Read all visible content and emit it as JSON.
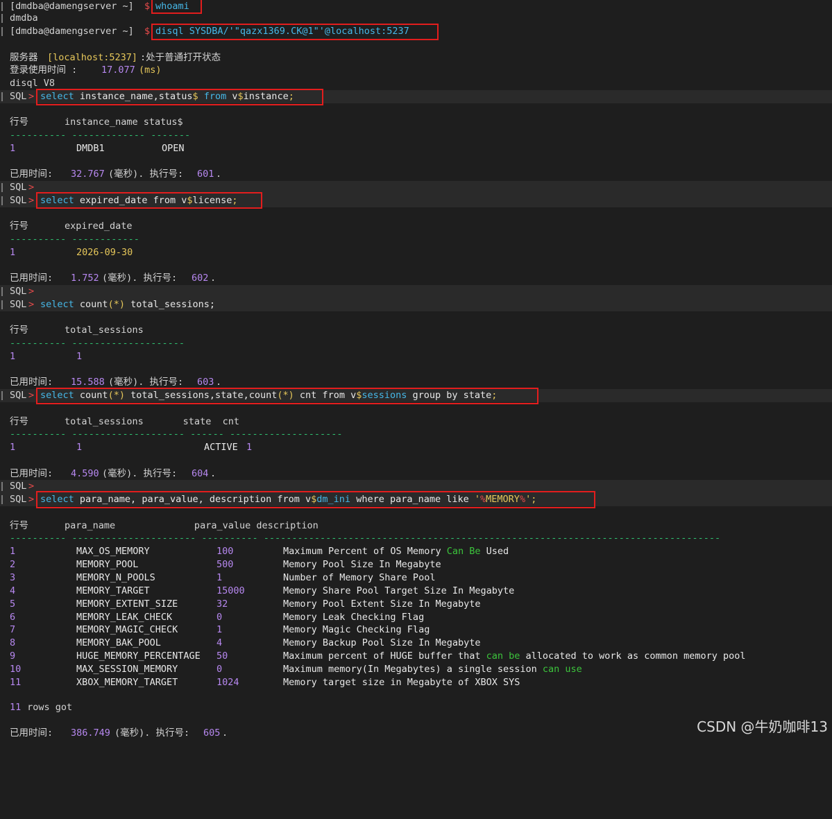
{
  "terminal": {
    "prompt_user": "[dmdba@damengserver ~]",
    "prompt_dollar": "$",
    "cmd_whoami": "whoami",
    "out_whoami": "dmdba",
    "cmd_disql": "disql SYSDBA/'\"qazx1369.CK@1\"'@localhost:5237",
    "server_label": "服务器",
    "server_addr": "[localhost:5237]",
    "server_state": ":处于普通打开状态",
    "login_label": "登录使用时间 : ",
    "login_value": "17.077",
    "ms_unit": "(ms)",
    "disql_version": "disql V8",
    "sql_prompt": "SQL",
    "gt": ">",
    "q1": {
      "select": "select",
      "cols": " instance_name,status",
      "dollar": "$",
      "from": " from ",
      "v": "v",
      "dollar2": "$",
      "tbl": "instance",
      "semi": ";",
      "header_row": "行号",
      "header_cols": "instance_name status$",
      "dashes": "---------- ------------- -------",
      "row_no": "1",
      "row_name": "DMDB1",
      "row_status": "OPEN",
      "elapsed_label": "已用时间: ",
      "elapsed_value": "32.767",
      "elapsed_unit": "(毫秒). 执行号:",
      "exec_no": "601",
      "dot": "."
    },
    "q2": {
      "select": "select",
      "rest": " expired_date from v",
      "dollar": "$",
      "tbl": "license",
      "semi": ";",
      "header_row": "行号",
      "header_cols": "expired_date",
      "dashes": "---------- ------------",
      "row_no": "1",
      "row_value": "2026-09-30",
      "elapsed_label": "已用时间: ",
      "elapsed_value": "1.752",
      "elapsed_unit": "(毫秒). 执行号:",
      "exec_no": "602",
      "dot": "."
    },
    "q3": {
      "select": "select",
      "rest1": " count",
      "paren": "(*)",
      "rest2": " total_sessions;",
      "header_row": "行号",
      "header_cols": "total_sessions",
      "dashes": "---------- --------------------",
      "row_no": "1",
      "row_value": "1",
      "elapsed_label": "已用时间: ",
      "elapsed_value": "15.588",
      "elapsed_unit": "(毫秒). 执行号:",
      "exec_no": "603",
      "dot": "."
    },
    "q4": {
      "select": "select",
      "a": " count",
      "p1": "(*)",
      "b": " total_sessions,state,count",
      "p2": "(*)",
      "c": " cnt from v",
      "dollar": "$",
      "tbl": "sessions",
      "d": " group by state",
      "semi": ";",
      "header_row": "行号",
      "header_cols": "total_sessions       state  cnt",
      "dashes": "---------- -------------------- ------ --------------------",
      "row_no": "1",
      "row_total": "1",
      "row_state": "ACTIVE",
      "row_cnt": "1",
      "elapsed_label": "已用时间: ",
      "elapsed_value": "4.590",
      "elapsed_unit": "(毫秒). 执行号:",
      "exec_no": "604",
      "dot": "."
    },
    "q5": {
      "select": "select",
      "a": " para_name, para_value, description from v",
      "dollar": "$",
      "tbl": "dm_ini",
      "b": " where para_name like ",
      "lit1": "'",
      "pct1": "%",
      "lit2": "MEMORY",
      "pct2": "%",
      "lit3": "'",
      "semi": ";",
      "header_row": "行号",
      "header_cols": "para_name              para_value description",
      "dashes": "---------- ---------------------- ---------- ---------------------------------------------------------------------------------",
      "rows": [
        {
          "no": "1",
          "name": "MAX_OS_MEMORY",
          "value": "100",
          "desc": "Maximum Percent of OS Memory ",
          "kw": "Can Be",
          "desc2": " Used"
        },
        {
          "no": "2",
          "name": "MEMORY_POOL",
          "value": "500",
          "desc": "Memory Pool Size In Megabyte"
        },
        {
          "no": "3",
          "name": "MEMORY_N_POOLS",
          "value": "1",
          "desc": "Number of Memory Share Pool"
        },
        {
          "no": "4",
          "name": "MEMORY_TARGET",
          "value": "15000",
          "desc": "Memory Share Pool Target Size In Megabyte"
        },
        {
          "no": "5",
          "name": "MEMORY_EXTENT_SIZE",
          "value": "32",
          "desc": "Memory Pool Extent Size In Megabyte"
        },
        {
          "no": "6",
          "name": "MEMORY_LEAK_CHECK",
          "value": "0",
          "desc": "Memory Leak Checking Flag"
        },
        {
          "no": "7",
          "name": "MEMORY_MAGIC_CHECK",
          "value": "1",
          "desc": "Memory Magic Checking Flag"
        },
        {
          "no": "8",
          "name": "MEMORY_BAK_POOL",
          "value": "4",
          "desc": "Memory Backup Pool Size In Megabyte"
        },
        {
          "no": "9",
          "name": "HUGE_MEMORY_PERCENTAGE",
          "value": "50",
          "desc": "Maximum percent of HUGE buffer that ",
          "kw": "can be",
          "desc2": " allocated to work as common memory pool"
        },
        {
          "no": "10",
          "name": "MAX_SESSION_MEMORY",
          "value": "0",
          "desc": "Maximum memory(In Megabytes) a single session ",
          "kw": "can use",
          "desc2": ""
        },
        {
          "no": "11",
          "name": "XBOX_MEMORY_TARGET",
          "value": "1024",
          "desc": "Memory target size in Megabyte of XBOX SYS"
        }
      ],
      "rows_count": "11",
      "rows_got": " rows got",
      "elapsed_label": "已用时间: ",
      "elapsed_value": "386.749",
      "elapsed_unit": "(毫秒). 执行号:",
      "exec_no": "605",
      "dot": "."
    }
  },
  "watermark": "CSDN @牛奶咖啡13"
}
